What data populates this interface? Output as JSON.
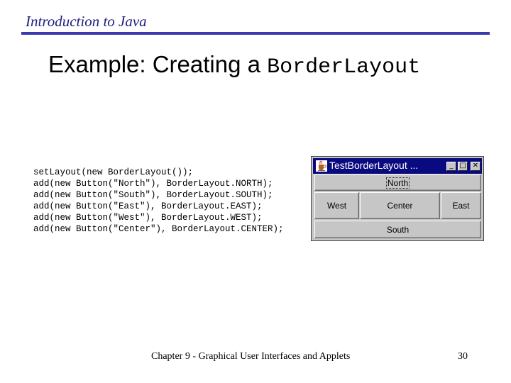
{
  "header": {
    "title": "Introduction to Java"
  },
  "slide": {
    "title_text": "Example: Creating a ",
    "title_code": "BorderLayout"
  },
  "code": {
    "lines": [
      "setLayout(new BorderLayout());",
      "add(new Button(\"North\"), BorderLayout.NORTH);",
      "add(new Button(\"South\"), BorderLayout.SOUTH);",
      "add(new Button(\"East\"), BorderLayout.EAST);",
      "add(new Button(\"West\"), BorderLayout.WEST);",
      "add(new Button(\"Center\"), BorderLayout.CENTER);"
    ]
  },
  "window": {
    "title": "TestBorderLayout ...",
    "controls": {
      "minimize": "_",
      "maximize": "□",
      "close": "✕"
    },
    "buttons": {
      "north": "North",
      "west": "West",
      "center": "Center",
      "east": "East",
      "south": "South"
    },
    "icon": "java-cup-icon"
  },
  "footer": {
    "chapter": "Chapter 9 - Graphical User Interfaces and Applets",
    "page_number": "30"
  },
  "colors": {
    "header_text": "#1f1f80",
    "header_rule": "#3a3ab0",
    "window_titlebar": "#0a0a80",
    "window_face": "#c6c6c6"
  }
}
